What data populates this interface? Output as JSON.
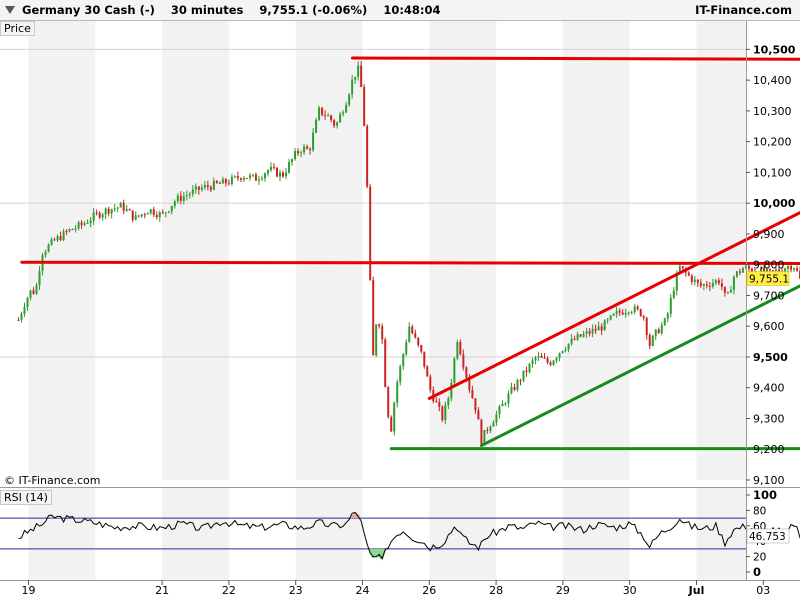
{
  "header": {
    "title": "Germany 30 Cash (-)",
    "timeframe": "30 minutes",
    "last_value": "9,755.1 (-0.06%)",
    "time": "10:48:04",
    "brand": "IT-Finance.com"
  },
  "price_pane": {
    "label": "Price",
    "copyright": "© IT-Finance.com"
  },
  "rsi_pane": {
    "label": "RSI (14)"
  },
  "colors": {
    "up": "#2e9c2e",
    "down": "#cc2222",
    "support": "#1a8a1a",
    "resistance": "#e60000",
    "current": "#ffee44"
  },
  "chart_data": [
    {
      "type": "candlestick",
      "title": "Germany 30 Cash (-)",
      "ylim": [
        9100,
        10550
      ],
      "y_ticks": [
        {
          "value": 10500,
          "label": "10,500",
          "bold": true
        },
        {
          "value": 10400,
          "label": "10,400",
          "bold": false
        },
        {
          "value": 10300,
          "label": "10,300",
          "bold": false
        },
        {
          "value": 10200,
          "label": "10,200",
          "bold": false
        },
        {
          "value": 10100,
          "label": "10,100",
          "bold": false
        },
        {
          "value": 10000,
          "label": "10,000",
          "bold": true
        },
        {
          "value": 9900,
          "label": "9,900",
          "bold": false
        },
        {
          "value": 9800,
          "label": "9,800",
          "bold": false
        },
        {
          "value": 9700,
          "label": "9,700",
          "bold": false
        },
        {
          "value": 9600,
          "label": "9,600",
          "bold": false
        },
        {
          "value": 9500,
          "label": "9,500",
          "bold": true
        },
        {
          "value": 9400,
          "label": "9,400",
          "bold": false
        },
        {
          "value": 9300,
          "label": "9,300",
          "bold": false
        },
        {
          "value": 9200,
          "label": "9,200",
          "bold": false
        },
        {
          "value": 9100,
          "label": "9,100",
          "bold": false
        }
      ],
      "x_ticks": [
        {
          "pos": 0,
          "label": "19",
          "bold": false
        },
        {
          "pos": 2,
          "label": "21",
          "bold": false
        },
        {
          "pos": 3,
          "label": "22",
          "bold": false
        },
        {
          "pos": 4,
          "label": "23",
          "bold": false
        },
        {
          "pos": 5,
          "label": "24",
          "bold": false
        },
        {
          "pos": 6,
          "label": "26",
          "bold": false
        },
        {
          "pos": 7,
          "label": "28",
          "bold": false
        },
        {
          "pos": 8,
          "label": "29",
          "bold": false
        },
        {
          "pos": 9,
          "label": "30",
          "bold": false
        },
        {
          "pos": 10,
          "label": "Jul",
          "bold": true
        },
        {
          "pos": 11,
          "label": "03",
          "bold": false
        }
      ],
      "session_position_max": 11.65,
      "last_price": {
        "value": 9755.1,
        "label": "9,755.1"
      },
      "close_path": [
        [
          -0.15,
          9620
        ],
        [
          -0.05,
          9680
        ],
        [
          0.05,
          9720
        ],
        [
          0.1,
          9705
        ],
        [
          0.2,
          9840
        ],
        [
          0.4,
          9880
        ],
        [
          0.6,
          9910
        ],
        [
          0.8,
          9930
        ],
        [
          1.0,
          9960
        ],
        [
          1.2,
          9980
        ],
        [
          1.4,
          9990
        ],
        [
          1.6,
          9950
        ],
        [
          1.8,
          9980
        ],
        [
          2.0,
          9960
        ],
        [
          2.2,
          10010
        ],
        [
          2.4,
          10030
        ],
        [
          2.6,
          10050
        ],
        [
          2.8,
          10060
        ],
        [
          3.0,
          10070
        ],
        [
          3.2,
          10090
        ],
        [
          3.4,
          10080
        ],
        [
          3.6,
          10110
        ],
        [
          3.8,
          10090
        ],
        [
          4.0,
          10160
        ],
        [
          4.1,
          10180
        ],
        [
          4.2,
          10170
        ],
        [
          4.35,
          10300
        ],
        [
          4.5,
          10280
        ],
        [
          4.6,
          10250
        ],
        [
          4.75,
          10330
        ],
        [
          4.85,
          10400
        ],
        [
          4.93,
          10440
        ],
        [
          5.0,
          10350
        ],
        [
          5.04,
          10200
        ],
        [
          5.08,
          10000
        ],
        [
          5.12,
          9700
        ],
        [
          5.16,
          9500
        ],
        [
          5.22,
          9650
        ],
        [
          5.3,
          9550
        ],
        [
          5.35,
          9380
        ],
        [
          5.42,
          9250
        ],
        [
          5.5,
          9400
        ],
        [
          5.6,
          9500
        ],
        [
          5.7,
          9600
        ],
        [
          5.8,
          9550
        ],
        [
          5.9,
          9500
        ],
        [
          6.0,
          9400
        ],
        [
          6.1,
          9350
        ],
        [
          6.2,
          9300
        ],
        [
          6.3,
          9380
        ],
        [
          6.42,
          9560
        ],
        [
          6.6,
          9400
        ],
        [
          6.7,
          9330
        ],
        [
          6.78,
          9230
        ],
        [
          6.9,
          9280
        ],
        [
          7.0,
          9310
        ],
        [
          7.2,
          9380
        ],
        [
          7.4,
          9440
        ],
        [
          7.6,
          9500
        ],
        [
          7.8,
          9480
        ],
        [
          8.0,
          9530
        ],
        [
          8.2,
          9560
        ],
        [
          8.4,
          9580
        ],
        [
          8.6,
          9600
        ],
        [
          8.8,
          9640
        ],
        [
          9.0,
          9660
        ],
        [
          9.2,
          9640
        ],
        [
          9.3,
          9540
        ],
        [
          9.4,
          9580
        ],
        [
          9.55,
          9620
        ],
        [
          9.65,
          9720
        ],
        [
          9.75,
          9790
        ],
        [
          9.9,
          9760
        ],
        [
          10.05,
          9730
        ],
        [
          10.2,
          9740
        ],
        [
          10.35,
          9750
        ],
        [
          10.45,
          9680
        ],
        [
          10.55,
          9760
        ],
        [
          10.7,
          9790
        ],
        [
          10.9,
          9780
        ],
        [
          11.1,
          9770
        ],
        [
          11.3,
          9790
        ],
        [
          11.45,
          9800
        ],
        [
          11.55,
          9755.1
        ]
      ],
      "trendlines": [
        {
          "name": "resistance-top",
          "color": "#e60000",
          "points": [
            [
              4.85,
              10472
            ],
            [
              11.6,
              10468
            ]
          ]
        },
        {
          "name": "resistance-mid",
          "color": "#e60000",
          "points": [
            [
              -0.1,
              9808
            ],
            [
              11.65,
              9804
            ]
          ]
        },
        {
          "name": "channel-top",
          "color": "#e60000",
          "points": [
            [
              6.0,
              9365
            ],
            [
              11.65,
              9980
            ]
          ]
        },
        {
          "name": "channel-bottom",
          "color": "#1a8a1a",
          "points": [
            [
              6.78,
              9212
            ],
            [
              11.65,
              9742
            ]
          ]
        },
        {
          "name": "support",
          "color": "#1a8a1a",
          "points": [
            [
              5.43,
              9202
            ],
            [
              11.65,
              9202
            ]
          ]
        }
      ]
    },
    {
      "type": "line",
      "title": "RSI (14)",
      "ylim": [
        0,
        100
      ],
      "y_ticks": [
        {
          "value": 100,
          "label": "100",
          "bold": true
        },
        {
          "value": 80,
          "label": "80",
          "bold": false
        },
        {
          "value": 60,
          "label": "60",
          "bold": false
        },
        {
          "value": 40,
          "label": "40",
          "bold": false
        },
        {
          "value": 20,
          "label": "20",
          "bold": false
        },
        {
          "value": 0,
          "label": "0",
          "bold": true
        }
      ],
      "overbought": 70,
      "oversold": 30,
      "last_value": {
        "value": 46.753,
        "label": "46.753"
      },
      "path": [
        [
          -0.15,
          45
        ],
        [
          0.05,
          55
        ],
        [
          0.2,
          62
        ],
        [
          0.35,
          72
        ],
        [
          0.5,
          70
        ],
        [
          0.7,
          68
        ],
        [
          1.0,
          64
        ],
        [
          1.3,
          58
        ],
        [
          1.6,
          60
        ],
        [
          2.0,
          57
        ],
        [
          2.3,
          63
        ],
        [
          2.6,
          56
        ],
        [
          2.9,
          66
        ],
        [
          3.2,
          60
        ],
        [
          3.5,
          58
        ],
        [
          3.8,
          62
        ],
        [
          4.1,
          57
        ],
        [
          4.35,
          64
        ],
        [
          4.55,
          60
        ],
        [
          4.75,
          62
        ],
        [
          4.88,
          78
        ],
        [
          4.95,
          74
        ],
        [
          5.02,
          50
        ],
        [
          5.08,
          30
        ],
        [
          5.14,
          18
        ],
        [
          5.22,
          20
        ],
        [
          5.3,
          15
        ],
        [
          5.38,
          35
        ],
        [
          5.5,
          48
        ],
        [
          5.6,
          55
        ],
        [
          5.75,
          45
        ],
        [
          5.9,
          40
        ],
        [
          6.0,
          32
        ],
        [
          6.2,
          38
        ],
        [
          6.4,
          62
        ],
        [
          6.5,
          45
        ],
        [
          6.6,
          38
        ],
        [
          6.75,
          32
        ],
        [
          6.85,
          46
        ],
        [
          7.0,
          52
        ],
        [
          7.2,
          60
        ],
        [
          7.4,
          56
        ],
        [
          7.6,
          64
        ],
        [
          7.8,
          58
        ],
        [
          8.0,
          60
        ],
        [
          8.3,
          55
        ],
        [
          8.5,
          62
        ],
        [
          8.8,
          58
        ],
        [
          9.0,
          63
        ],
        [
          9.2,
          48
        ],
        [
          9.3,
          33
        ],
        [
          9.45,
          50
        ],
        [
          9.6,
          58
        ],
        [
          9.75,
          70
        ],
        [
          9.9,
          60
        ],
        [
          10.1,
          56
        ],
        [
          10.3,
          60
        ],
        [
          10.42,
          38
        ],
        [
          10.55,
          55
        ],
        [
          10.75,
          60
        ],
        [
          10.95,
          52
        ],
        [
          11.15,
          56
        ],
        [
          11.35,
          50
        ],
        [
          11.48,
          66
        ],
        [
          11.55,
          40
        ],
        [
          11.6,
          46.753
        ]
      ]
    }
  ]
}
